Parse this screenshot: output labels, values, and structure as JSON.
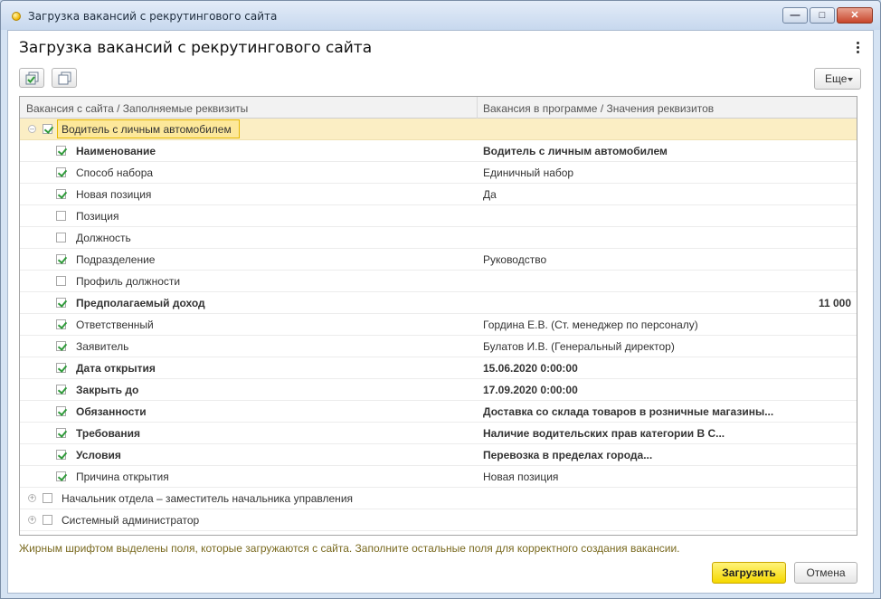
{
  "window": {
    "title": "Загрузка вакансий с рекрутингового сайта"
  },
  "form": {
    "title": "Загрузка вакансий с рекрутингового сайта"
  },
  "toolbar": {
    "more_label": "Еще"
  },
  "grid": {
    "columns": [
      "Вакансия с сайта / Заполняемые реквизиты",
      "Вакансия в программе / Значения реквизитов"
    ],
    "group1": {
      "label": "Водитель с личным автомобилем",
      "checked": true,
      "expanded": true
    },
    "rows": [
      {
        "label": "Наименование",
        "value": "Водитель с личным автомобилем",
        "checked": true,
        "bold": true
      },
      {
        "label": "Способ набора",
        "value": "Единичный набор",
        "checked": true,
        "bold": false
      },
      {
        "label": "Новая позиция",
        "value": "Да",
        "checked": true,
        "bold": false
      },
      {
        "label": "Позиция",
        "value": "",
        "checked": false,
        "bold": false
      },
      {
        "label": "Должность",
        "value": "",
        "checked": false,
        "bold": false
      },
      {
        "label": "Подразделение",
        "value": "Руководство",
        "checked": true,
        "bold": false
      },
      {
        "label": "Профиль должности",
        "value": "",
        "checked": false,
        "bold": false
      },
      {
        "label": "Предполагаемый доход",
        "value": "11 000",
        "checked": true,
        "bold": true,
        "numeric": true
      },
      {
        "label": "Ответственный",
        "value": "Гордина Е.В. (Ст. менеджер по персоналу)",
        "checked": true,
        "bold": false
      },
      {
        "label": "Заявитель",
        "value": "Булатов И.В. (Генеральный директор)",
        "checked": true,
        "bold": false
      },
      {
        "label": "Дата открытия",
        "value": "15.06.2020 0:00:00",
        "checked": true,
        "bold": true
      },
      {
        "label": "Закрыть до",
        "value": "17.09.2020 0:00:00",
        "checked": true,
        "bold": true
      },
      {
        "label": "Обязанности",
        "value": "Доставка со склада товаров в розничные магазины...",
        "checked": true,
        "bold": true
      },
      {
        "label": "Требования",
        "value": "Наличие водительских прав категории В С...",
        "checked": true,
        "bold": true
      },
      {
        "label": "Условия",
        "value": "Перевозка в пределах города...",
        "checked": true,
        "bold": true
      },
      {
        "label": "Причина открытия",
        "value": "Новая позиция",
        "checked": true,
        "bold": false
      }
    ],
    "group2": {
      "label": "Начальник отдела – заместитель начальника управления",
      "checked": false
    },
    "group3": {
      "label": "Системный администратор",
      "checked": false
    }
  },
  "footer": {
    "hint": "Жирным шрифтом выделены поля, которые загружаются с сайта. Заполните остальные поля для корректного создания вакансии.",
    "load_label": "Загрузить",
    "cancel_label": "Отмена"
  }
}
